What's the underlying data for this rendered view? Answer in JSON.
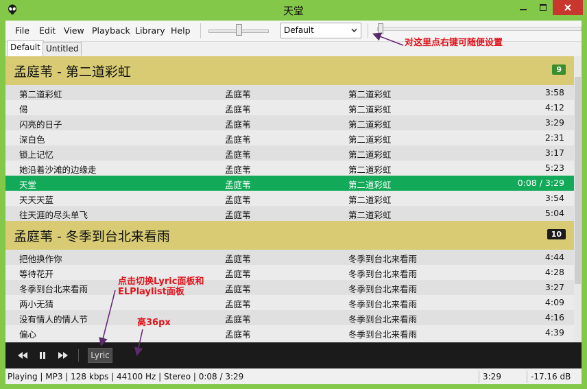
{
  "window": {
    "title": "天堂"
  },
  "menu": [
    "File",
    "Edit",
    "View",
    "Playback",
    "Library",
    "Help"
  ],
  "toolbar": {
    "output_select": "Default"
  },
  "tabs": [
    "Default",
    "Untitled"
  ],
  "groups": [
    {
      "title": "孟庭苇 - 第二道彩虹",
      "count": "9",
      "count_color": "#3a8f2c",
      "tracks": [
        {
          "title": "第二道彩虹",
          "artist": "孟庭苇",
          "album": "第二道彩虹",
          "duration": "3:58"
        },
        {
          "title": "偈",
          "artist": "孟庭苇",
          "album": "第二道彩虹",
          "duration": "4:12"
        },
        {
          "title": "闪亮的日子",
          "artist": "孟庭苇",
          "album": "第二道彩虹",
          "duration": "3:29"
        },
        {
          "title": "深白色",
          "artist": "孟庭苇",
          "album": "第二道彩虹",
          "duration": "2:31"
        },
        {
          "title": "锁上记忆",
          "artist": "孟庭苇",
          "album": "第二道彩虹",
          "duration": "3:17"
        },
        {
          "title": "她沿着沙滩的边缘走",
          "artist": "孟庭苇",
          "album": "第二道彩虹",
          "duration": "5:23"
        },
        {
          "title": "天堂",
          "artist": "孟庭苇",
          "album": "第二道彩虹",
          "duration": "0:08 / 3:29",
          "playing": true
        },
        {
          "title": "天天天蓝",
          "artist": "孟庭苇",
          "album": "第二道彩虹",
          "duration": "3:54"
        },
        {
          "title": "往天涯的尽头单飞",
          "artist": "孟庭苇",
          "album": "第二道彩虹",
          "duration": "5:04"
        }
      ]
    },
    {
      "title": "孟庭苇 - 冬季到台北来看雨",
      "count": "10",
      "count_color": "#1b1b1b",
      "tracks": [
        {
          "title": "把他换作你",
          "artist": "孟庭苇",
          "album": "冬季到台北来看雨",
          "duration": "4:44"
        },
        {
          "title": "等待花开",
          "artist": "孟庭苇",
          "album": "冬季到台北来看雨",
          "duration": "4:28"
        },
        {
          "title": "冬季到台北来看雨",
          "artist": "孟庭苇",
          "album": "冬季到台北来看雨",
          "duration": "3:27"
        },
        {
          "title": "两小无猜",
          "artist": "孟庭苇",
          "album": "冬季到台北来看雨",
          "duration": "4:09"
        },
        {
          "title": "没有情人的情人节",
          "artist": "孟庭苇",
          "album": "冬季到台北来看雨",
          "duration": "4:16"
        },
        {
          "title": "偏心",
          "artist": "孟庭苇",
          "album": "冬季到台北来看雨",
          "duration": "4:39"
        }
      ]
    }
  ],
  "controls": {
    "lyric_label": "Lyric"
  },
  "status": {
    "info": "Playing | MP3 | 128 kbps | 44100 Hz | Stereo | 0:08 / 3:29",
    "length": "3:29",
    "gain": "-17.16 dB"
  },
  "annotations": {
    "seekbar_note": "对这里点右键可随便设置",
    "lyric_note": "点击切换Lyric面板和ELPlaylist面板",
    "height_note": "高36px"
  },
  "colors": {
    "titlebar": "#84c84a",
    "group_header": "#d8cb73",
    "playing_row": "#12a958",
    "annotation": "#e0141d"
  }
}
